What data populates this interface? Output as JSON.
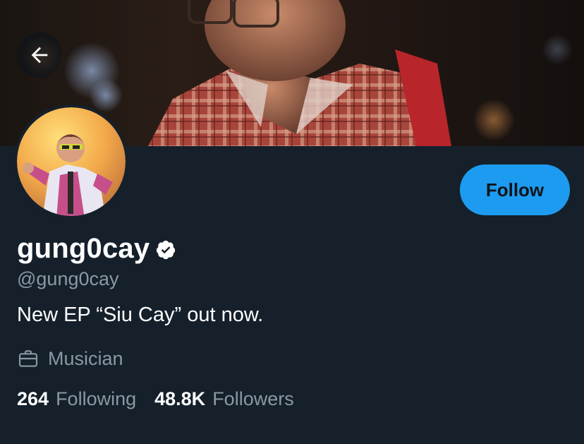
{
  "header": {
    "back_icon": "arrow-left-icon"
  },
  "profile": {
    "display_name": "gung0cay",
    "verified_icon": "verified-badge-icon",
    "handle": "@gung0cay",
    "bio": "New EP “Siu Cay” out now.",
    "category_icon": "briefcase-icon",
    "category": "Musician",
    "follow_label": "Follow"
  },
  "stats": {
    "following_count": "264",
    "following_label": "Following",
    "followers_count": "48.8K",
    "followers_label": "Followers"
  },
  "colors": {
    "background": "#15202b",
    "accent": "#1d9bf0",
    "secondary_text": "#8b98a5",
    "primary_text": "#ffffff"
  }
}
